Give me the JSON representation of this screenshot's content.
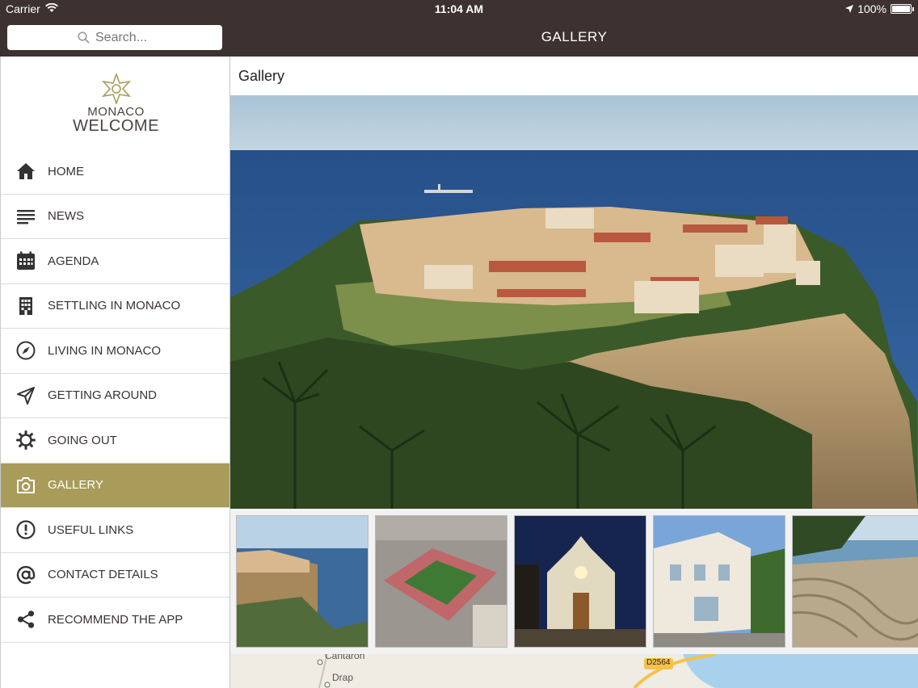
{
  "status_bar": {
    "carrier": "Carrier",
    "time": "11:04 AM",
    "battery": "100%"
  },
  "search": {
    "placeholder": "Search..."
  },
  "nav": {
    "title": "GALLERY"
  },
  "logo": {
    "line1": "MONACO",
    "line2": "WELCOME"
  },
  "menu": [
    {
      "label": "HOME",
      "icon": "home-icon"
    },
    {
      "label": "NEWS",
      "icon": "news-icon"
    },
    {
      "label": "AGENDA",
      "icon": "calendar-icon"
    },
    {
      "label": "SETTLING IN MONACO",
      "icon": "building-icon"
    },
    {
      "label": "LIVING IN MONACO",
      "icon": "compass-icon"
    },
    {
      "label": "GETTING AROUND",
      "icon": "navigation-arrow-icon"
    },
    {
      "label": "GOING OUT",
      "icon": "gear-icon"
    },
    {
      "label": "GALLERY",
      "icon": "camera-icon",
      "active": true
    },
    {
      "label": "USEFUL LINKS",
      "icon": "info-icon"
    },
    {
      "label": "CONTACT DETAILS",
      "icon": "at-icon"
    },
    {
      "label": "RECOMMEND THE APP",
      "icon": "share-icon"
    }
  ],
  "content": {
    "title": "Gallery",
    "map_labels": {
      "place1": "Cantaron",
      "place2": "Drap",
      "road": "D2564"
    }
  },
  "colors": {
    "bar": "#3d3230",
    "accent": "#a99b59"
  }
}
